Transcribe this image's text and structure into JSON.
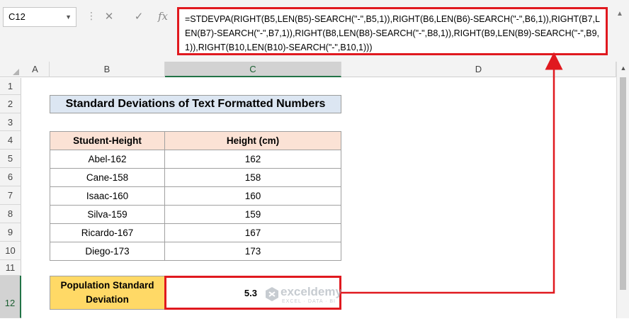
{
  "formula_bar": {
    "name_box": "C12",
    "cancel_glyph": "✕",
    "enter_glyph": "✓",
    "fx_label": "fx",
    "formula": "=STDEVPA(RIGHT(B5,LEN(B5)-SEARCH(\"-\",B5,1)),RIGHT(B6,LEN(B6)-SEARCH(\"-\",B6,1)),RIGHT(B7,LEN(B7)-SEARCH(\"-\",B7,1)),RIGHT(B8,LEN(B8)-SEARCH(\"-\",B8,1)),RIGHT(B9,LEN(B9)-SEARCH(\"-\",B9,1)),RIGHT(B10,LEN(B10)-SEARCH(\"-\",B10,1)))"
  },
  "columns": [
    "A",
    "B",
    "C",
    "D"
  ],
  "selected_column": "C",
  "rows": [
    "1",
    "2",
    "3",
    "4",
    "5",
    "6",
    "7",
    "8",
    "9",
    "10",
    "11",
    "12"
  ],
  "selected_row": "12",
  "sheet": {
    "title": "Standard Deviations of Text Formatted Numbers",
    "headers": [
      "Student-Height",
      "Height (cm)"
    ],
    "data": [
      [
        "Abel-162",
        "162"
      ],
      [
        "Cane-158",
        "158"
      ],
      [
        "Isaac-160",
        "160"
      ],
      [
        "Silva-159",
        "159"
      ],
      [
        "Ricardo-167",
        "167"
      ],
      [
        "Diego-173",
        "173"
      ]
    ],
    "result_label_line1": "Population Standard",
    "result_label_line2": "Deviation",
    "result_value": "5.3"
  },
  "watermark": {
    "name": "exceldemy",
    "tagline": "EXCEL · DATA · BI"
  },
  "colors": {
    "highlight_red": "#e0191f",
    "title_fill": "#dce6f2",
    "header_fill": "#fbe2d5",
    "result_fill": "#ffd966",
    "excel_green": "#217346"
  }
}
